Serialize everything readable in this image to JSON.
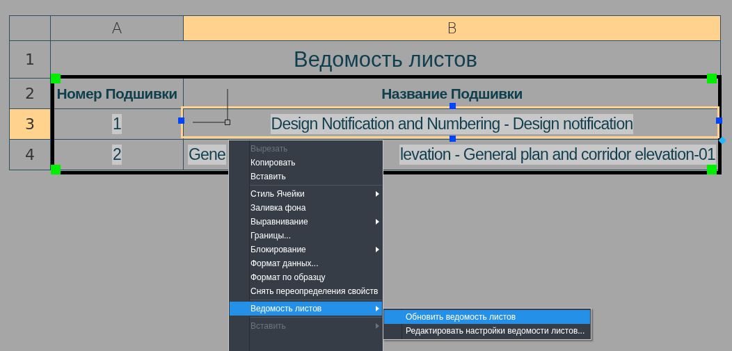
{
  "columns": [
    {
      "label": "A",
      "selected": false
    },
    {
      "label": "B",
      "selected": true
    }
  ],
  "title_row": {
    "row_label": "1",
    "title": "Ведомость листов"
  },
  "rows": [
    {
      "row_label": "2",
      "kind": "header",
      "selected": false,
      "cells": [
        {
          "texts": [
            "Номер Подшивки"
          ]
        },
        {
          "texts": [
            "Название Подшивки"
          ]
        }
      ]
    },
    {
      "row_label": "3",
      "kind": "data",
      "selected": true,
      "cells": [
        {
          "texts": [
            "1"
          ]
        },
        {
          "texts": [
            "Design Notification and Numbering - Design notification"
          ]
        }
      ]
    },
    {
      "row_label": "4",
      "kind": "data",
      "selected": false,
      "cells": [
        {
          "texts": [
            "2"
          ]
        },
        {
          "texts": [
            "Gene",
            "levation - General plan and corridor elevation-01"
          ]
        }
      ]
    }
  ],
  "context_menu": {
    "items": [
      {
        "kind": "item",
        "label": "Вырезать",
        "disabled": true,
        "selected": false,
        "submenu": false
      },
      {
        "kind": "item",
        "label": "Копировать",
        "disabled": false,
        "selected": false,
        "submenu": false
      },
      {
        "kind": "item",
        "label": "Вставить",
        "disabled": false,
        "selected": false,
        "submenu": false
      },
      {
        "kind": "separator"
      },
      {
        "kind": "item",
        "label": "Стиль Ячейки",
        "disabled": false,
        "selected": false,
        "submenu": true
      },
      {
        "kind": "item",
        "label": "Заливка фона",
        "disabled": false,
        "selected": false,
        "submenu": false
      },
      {
        "kind": "item",
        "label": "Выравнивание",
        "disabled": false,
        "selected": false,
        "submenu": true
      },
      {
        "kind": "item",
        "label": "Границы...",
        "disabled": false,
        "selected": false,
        "submenu": false
      },
      {
        "kind": "item",
        "label": "Блокирование",
        "disabled": false,
        "selected": false,
        "submenu": true
      },
      {
        "kind": "item",
        "label": "Формат данных...",
        "disabled": false,
        "selected": false,
        "submenu": false
      },
      {
        "kind": "item",
        "label": "Формат по образцу",
        "disabled": false,
        "selected": false,
        "submenu": false
      },
      {
        "kind": "item",
        "label": "Снять переопределения свойств",
        "disabled": false,
        "selected": false,
        "submenu": false
      },
      {
        "kind": "separator"
      },
      {
        "kind": "item",
        "label": "Ведомость листов",
        "disabled": false,
        "selected": true,
        "submenu": true
      },
      {
        "kind": "separator"
      },
      {
        "kind": "item",
        "label": "Вставить",
        "disabled": true,
        "selected": false,
        "submenu": true
      }
    ]
  },
  "submenu": {
    "items": [
      {
        "label": "Обновить ведомость листов",
        "selected": true
      },
      {
        "label": "Редактировать настройки ведомости листов...",
        "selected": false
      }
    ]
  }
}
